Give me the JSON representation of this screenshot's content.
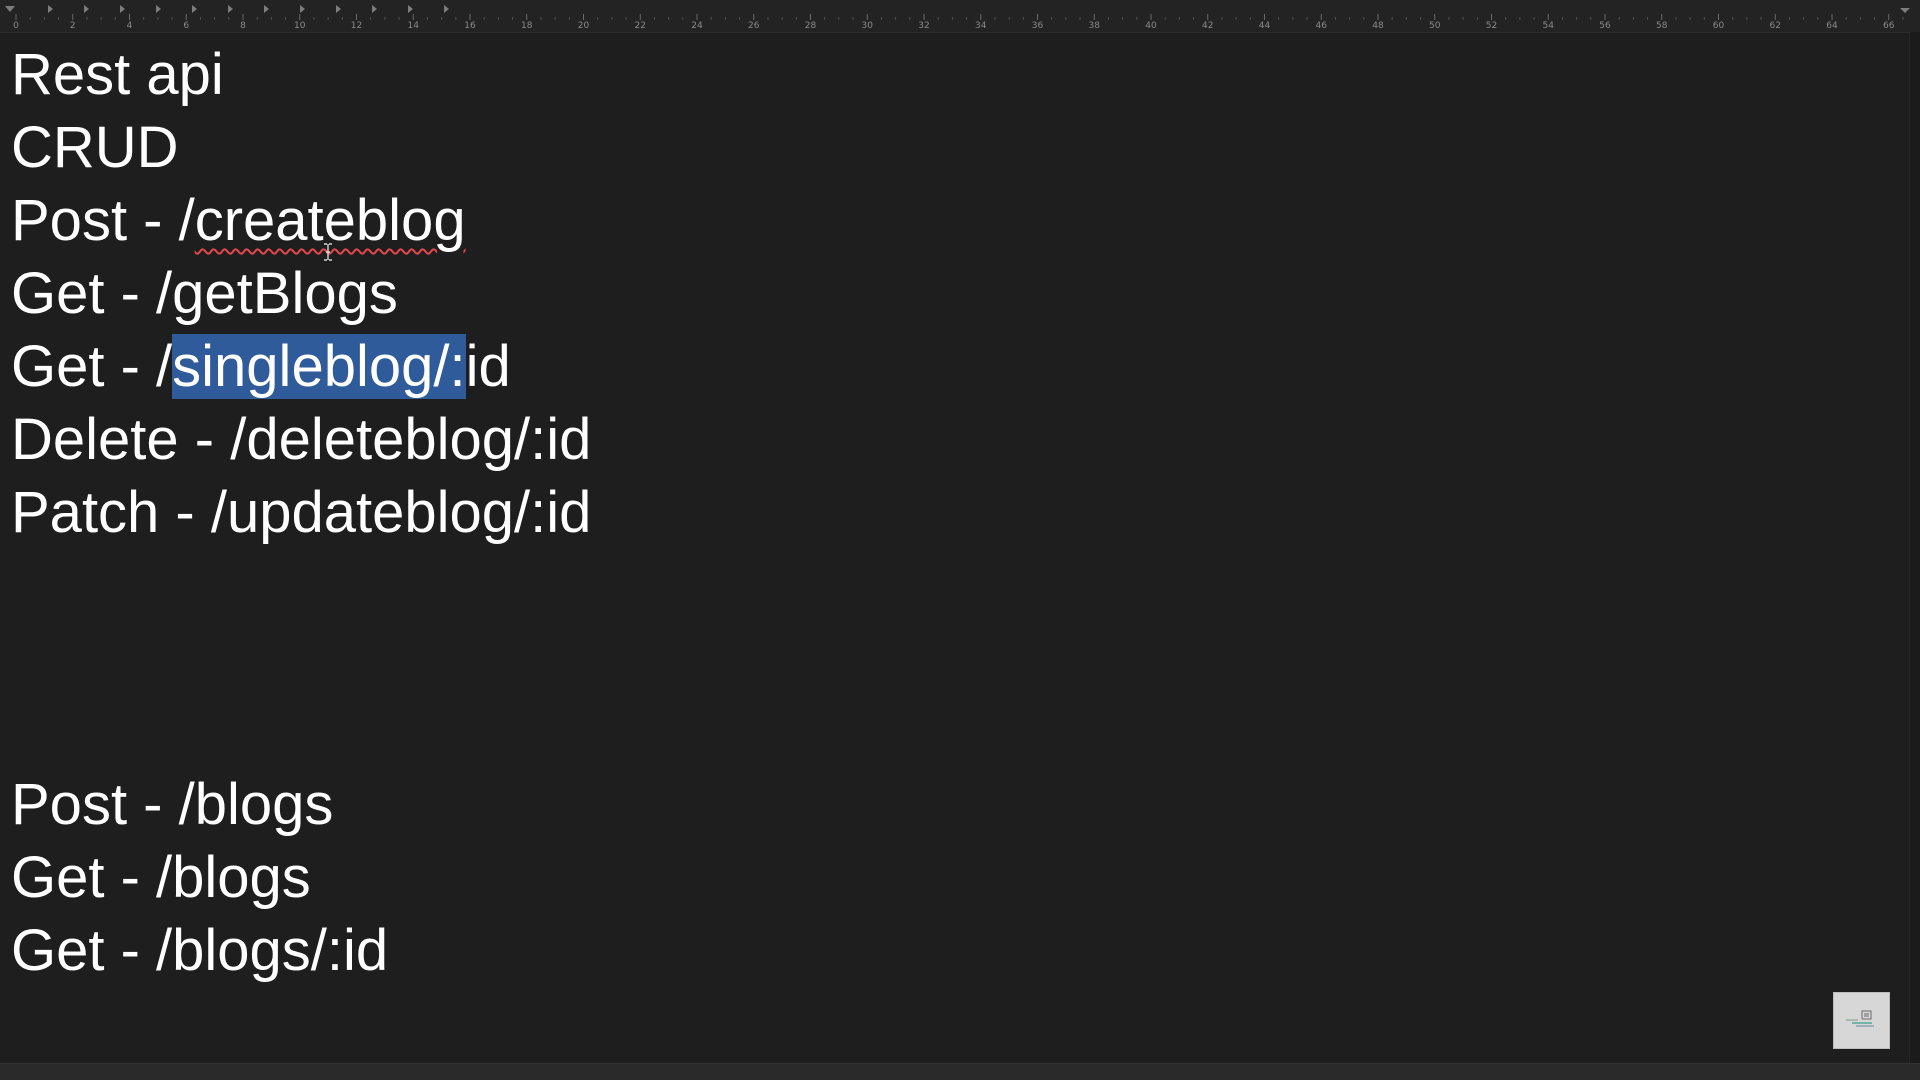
{
  "ruler": {
    "labels": [
      "0",
      "2",
      "4",
      "6",
      "8",
      "10",
      "12",
      "14",
      "16",
      "18",
      "20",
      "22",
      "24",
      "26",
      "28",
      "30",
      "32",
      "34",
      "36",
      "38",
      "40",
      "42",
      "44",
      "46",
      "48",
      "50",
      "52",
      "54",
      "56",
      "58",
      "60",
      "62",
      "64",
      "66"
    ]
  },
  "document": {
    "lines": [
      {
        "text": "Rest api"
      },
      {
        "text": "CRUD"
      },
      {
        "prefix": "Post - /",
        "misspelled": "createblog"
      },
      {
        "text": "Get - /getBlogs"
      },
      {
        "prefix": "Get - /",
        "selected": "singleblog/:",
        "suffix": "id"
      },
      {
        "text": "Delete - /deleteblog/:id"
      },
      {
        "text": "Patch - /updateblog/:id"
      },
      {
        "text": "Post - /blogs"
      },
      {
        "text": "Get - /blogs"
      },
      {
        "text": "Get - /blogs/:id"
      }
    ]
  },
  "colors": {
    "background": "#1e1e1e",
    "text": "#ffffff",
    "selection": "#2f5b9a",
    "spellcheck_underline": "#e2484b"
  },
  "icons": {
    "cursor": "text-ibeam-cursor",
    "thumbnail": "window-thumbnail-icon"
  }
}
